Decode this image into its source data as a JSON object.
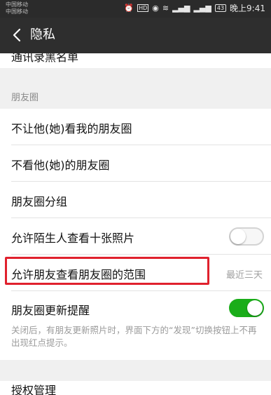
{
  "status_bar": {
    "carrier_1": "中国移动",
    "carrier_2": "中国移动",
    "time": "晚上9:41",
    "battery": "43"
  },
  "header": {
    "title": "隐私"
  },
  "list": {
    "partial_top_item": "通讯录黑名单",
    "moments_section_label": "朋友圈",
    "items": [
      {
        "label": "不让他(她)看我的朋友圈"
      },
      {
        "label": "不看他(她)的朋友圈"
      },
      {
        "label": "朋友圈分组"
      }
    ],
    "stranger_photos": {
      "label": "允许陌生人查看十张照片",
      "enabled": false
    },
    "visible_range": {
      "label": "允许朋友查看朋友圈的范围",
      "value": "最近三天"
    },
    "update_reminder": {
      "label": "朋友圈更新提醒",
      "enabled": true
    },
    "reminder_description": "关闭后，有朋友更新照片时，界面下方的“发现”切换按钮上不再出现红点提示。",
    "authorization": {
      "label": "授权管理"
    }
  },
  "colors": {
    "toggle_on": "#1aad19",
    "highlight_box": "#e0212d",
    "titlebar": "#2e2e2e"
  }
}
